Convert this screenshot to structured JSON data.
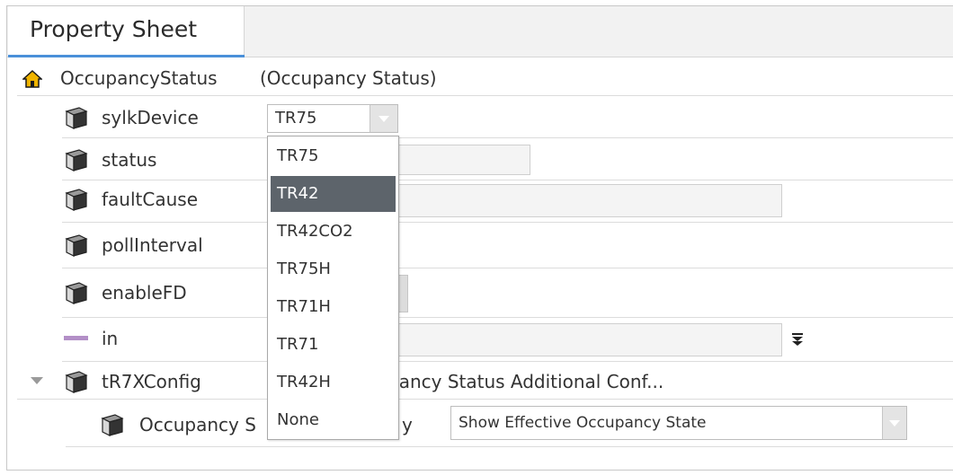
{
  "tab": {
    "label": "Property Sheet"
  },
  "root": {
    "name": "OccupancyStatus",
    "display": "(Occupancy Status)"
  },
  "props": {
    "sylkDevice": {
      "label": "sylkDevice",
      "value": "TR75"
    },
    "status": {
      "label": "status"
    },
    "faultCause": {
      "label": "faultCause"
    },
    "pollInterval": {
      "label": "pollInterval"
    },
    "enableFD": {
      "label": "enableFD"
    },
    "in": {
      "label": "in"
    },
    "tR7XConfig": {
      "label": "tR7XConfig",
      "display_visible": "pancy Status Additional Conf..."
    },
    "occupancy": {
      "label_left": "Occupancy S",
      "label_right": "y",
      "value": "Show Effective Occupancy State"
    }
  },
  "dropdown": {
    "options": [
      "TR75",
      "TR42",
      "TR42CO2",
      "TR75H",
      "TR71H",
      "TR71",
      "TR42H",
      "None"
    ],
    "highlighted": "TR42"
  },
  "icons": {
    "root": "house-icon",
    "component": "cube-icon",
    "slot": "slot-bar-icon",
    "expand": "triangle-down-icon",
    "pin": "pin-arrow-icon"
  },
  "colors": {
    "tab_underline": "#4a90d9",
    "highlight": "#5d646b",
    "slot_bar": "#b38fc7"
  }
}
